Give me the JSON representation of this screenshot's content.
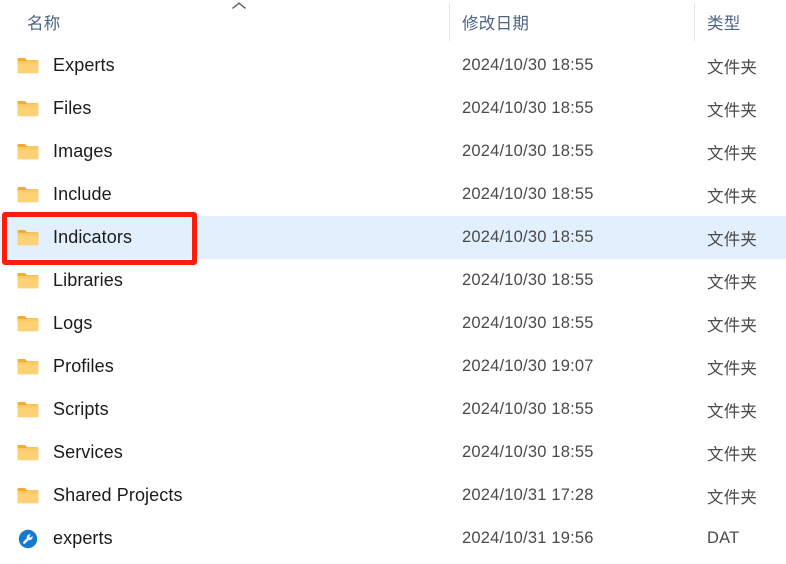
{
  "header": {
    "columns": [
      {
        "label": "名称",
        "name": "column-header-name"
      },
      {
        "label": "修改日期",
        "name": "column-header-date-modified"
      },
      {
        "label": "类型",
        "name": "column-header-type"
      }
    ],
    "sort_indicator": "chevron-up-icon",
    "sorted_column": "名称",
    "sort_direction": "ascending"
  },
  "colors": {
    "selection_background": "#e2effc",
    "annotation_box": "#fa1e0a",
    "header_text": "#4d6585",
    "folder_icon_body": "#fdd277",
    "folder_icon_tab": "#f3b33d",
    "dat_icon_circle": "#1479d0"
  },
  "annotation": {
    "target_row": "Indicators",
    "shape": "rectangle",
    "color": "#fa1e0a"
  },
  "rows": [
    {
      "icon": "folder-icon",
      "name": "Experts",
      "date": "2024/10/30 18:55",
      "type": "文件夹",
      "selected": false
    },
    {
      "icon": "folder-icon",
      "name": "Files",
      "date": "2024/10/30 18:55",
      "type": "文件夹",
      "selected": false
    },
    {
      "icon": "folder-icon",
      "name": "Images",
      "date": "2024/10/30 18:55",
      "type": "文件夹",
      "selected": false
    },
    {
      "icon": "folder-icon",
      "name": "Include",
      "date": "2024/10/30 18:55",
      "type": "文件夹",
      "selected": false
    },
    {
      "icon": "folder-icon",
      "name": "Indicators",
      "date": "2024/10/30 18:55",
      "type": "文件夹",
      "selected": true
    },
    {
      "icon": "folder-icon",
      "name": "Libraries",
      "date": "2024/10/30 18:55",
      "type": "文件夹",
      "selected": false
    },
    {
      "icon": "folder-icon",
      "name": "Logs",
      "date": "2024/10/30 18:55",
      "type": "文件夹",
      "selected": false
    },
    {
      "icon": "folder-icon",
      "name": "Profiles",
      "date": "2024/10/30 19:07",
      "type": "文件夹",
      "selected": false
    },
    {
      "icon": "folder-icon",
      "name": "Scripts",
      "date": "2024/10/30 18:55",
      "type": "文件夹",
      "selected": false
    },
    {
      "icon": "folder-icon",
      "name": "Services",
      "date": "2024/10/30 18:55",
      "type": "文件夹",
      "selected": false
    },
    {
      "icon": "folder-icon",
      "name": "Shared Projects",
      "date": "2024/10/31 17:28",
      "type": "文件夹",
      "selected": false
    },
    {
      "icon": "dat-file-icon",
      "name": "experts",
      "date": "2024/10/31 19:56",
      "type": "DAT",
      "selected": false
    }
  ]
}
